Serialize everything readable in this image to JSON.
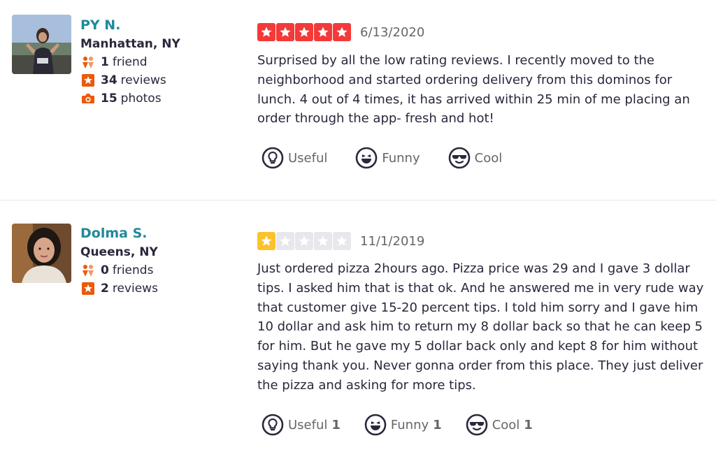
{
  "colors": {
    "accent_name": "#1f8a99",
    "star_red": "#f43939",
    "star_yellow": "#fcc22a",
    "star_empty": "#e8e8ec",
    "stat_icon": "#ea5a0c",
    "text": "#2b273c",
    "muted": "#666666"
  },
  "reviews": [
    {
      "user": {
        "name": "PY N.",
        "location": "Manhattan, NY",
        "stats": [
          {
            "icon": "friends-icon",
            "count": "1",
            "label": "friend"
          },
          {
            "icon": "star-badge-icon",
            "count": "34",
            "label": "reviews"
          },
          {
            "icon": "camera-icon",
            "count": "15",
            "label": "photos"
          }
        ]
      },
      "rating": 5,
      "date": "6/13/2020",
      "text": "Surprised by all the low rating reviews. I recently moved to the neighborhood and started ordering delivery from this dominos for lunch. 4 out of 4 times, it has arrived within 25 min of me placing an order through the app- fresh and hot!",
      "actions": {
        "useful": {
          "label": "Useful",
          "count": ""
        },
        "funny": {
          "label": "Funny",
          "count": ""
        },
        "cool": {
          "label": "Cool",
          "count": ""
        }
      }
    },
    {
      "user": {
        "name": "Dolma S.",
        "location": "Queens, NY",
        "stats": [
          {
            "icon": "friends-icon",
            "count": "0",
            "label": "friends"
          },
          {
            "icon": "star-badge-icon",
            "count": "2",
            "label": "reviews"
          }
        ]
      },
      "rating": 1,
      "date": "11/1/2019",
      "text": "Just ordered pizza 2hours ago. Pizza price was 29 and I gave 3 dollar tips. I asked him that is that ok. And he answered me in very rude way that customer give 15-20 percent tips. I told him sorry and I gave him 10 dollar and ask him to return my 8 dollar back so that he can keep 5 for him. But he gave my 5 dollar back only and kept 8 for him without saying thank you. Never gonna order from this place. They just deliver the pizza and asking for   more tips.",
      "actions": {
        "useful": {
          "label": "Useful",
          "count": "1"
        },
        "funny": {
          "label": "Funny",
          "count": "1"
        },
        "cool": {
          "label": "Cool",
          "count": "1"
        }
      }
    }
  ]
}
